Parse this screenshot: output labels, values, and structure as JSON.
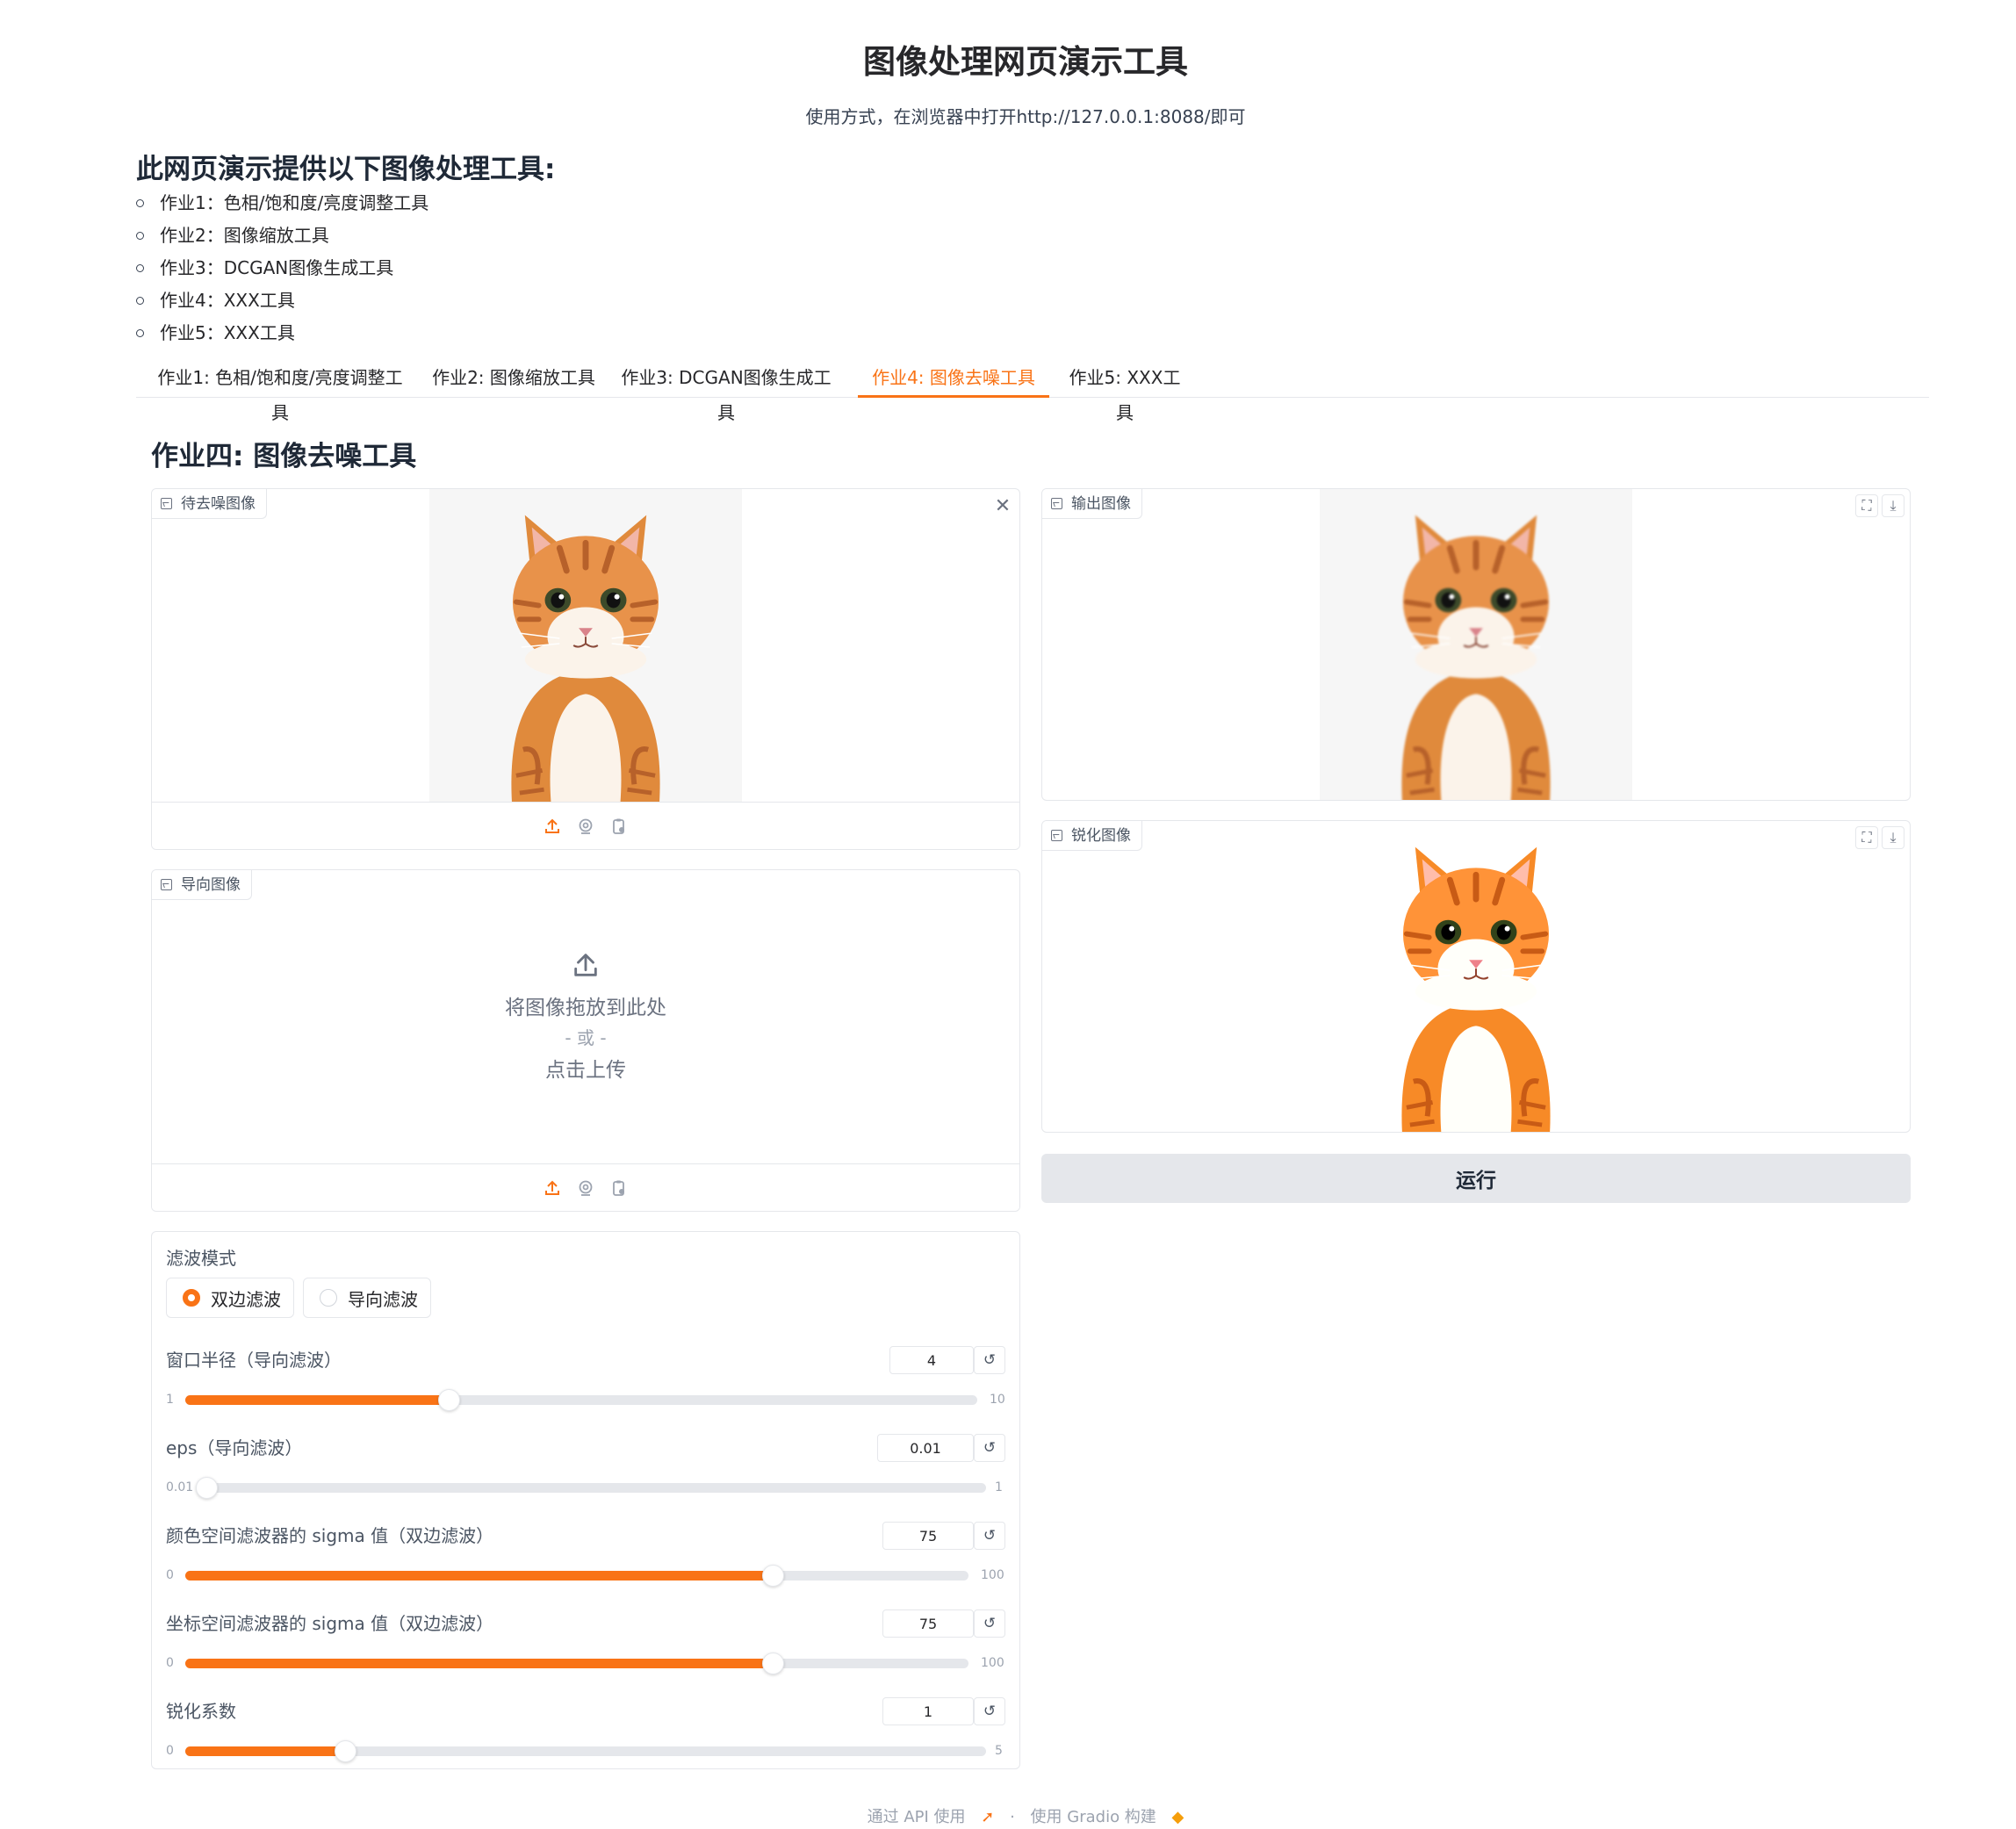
{
  "header": {
    "title": "图像处理网页演示工具",
    "usage": "使用方式，在浏览器中打开http://127.0.0.1:8088/即可"
  },
  "intro": {
    "heading": "此网页演示提供以下图像处理工具:",
    "items": [
      "作业1：色相/饱和度/亮度调整工具",
      "作业2：图像缩放工具",
      "作业3：DCGAN图像生成工具",
      "作业4：XXX工具",
      "作业5：XXX工具"
    ]
  },
  "tabs": [
    {
      "label": "作业1: 色相/饱和度/亮度调整工具",
      "active": false
    },
    {
      "label": "作业2: 图像缩放工具",
      "active": false
    },
    {
      "label": "作业3: DCGAN图像生成工具",
      "active": false
    },
    {
      "label": "作业4: 图像去噪工具",
      "active": true
    },
    {
      "label": "作业5: XXX工具",
      "active": false
    }
  ],
  "section_title": "作业四: 图像去噪工具",
  "inputs": {
    "noisy_image_label": "待去噪图像",
    "guide_image_label": "导向图像",
    "upload_text": "将图像拖放到此处",
    "upload_or": "- 或 -",
    "upload_click": "点击上传"
  },
  "outputs": {
    "output_image_label": "输出图像",
    "sharpened_image_label": "锐化图像"
  },
  "run_button": "运行",
  "controls": {
    "filter_mode_label": "滤波模式",
    "filter_options": [
      "双边滤波",
      "导向滤波"
    ],
    "filter_selected": "双边滤波",
    "sliders": [
      {
        "label": "窗口半径（导向滤波）",
        "value": "4",
        "min": "1",
        "max": "10",
        "fraction": 0.333
      },
      {
        "label": "eps（导向滤波）",
        "value": "0.01",
        "min": "0.01",
        "max": "1",
        "fraction": 0.0
      },
      {
        "label": "颜色空间滤波器的 sigma 值（双边滤波）",
        "value": "75",
        "min": "0",
        "max": "100",
        "fraction": 0.75
      },
      {
        "label": "坐标空间滤波器的 sigma 值（双边滤波）",
        "value": "75",
        "min": "0",
        "max": "100",
        "fraction": 0.75
      },
      {
        "label": "锐化系数",
        "value": "1",
        "min": "0",
        "max": "5",
        "fraction": 0.2
      }
    ]
  },
  "footer": {
    "api": "通过 API 使用",
    "separator": "·",
    "built": "使用 Gradio 构建"
  },
  "colors": {
    "accent": "#f97316",
    "cat_orange": "#e08a3c",
    "panel_border": "#e5e7eb"
  }
}
